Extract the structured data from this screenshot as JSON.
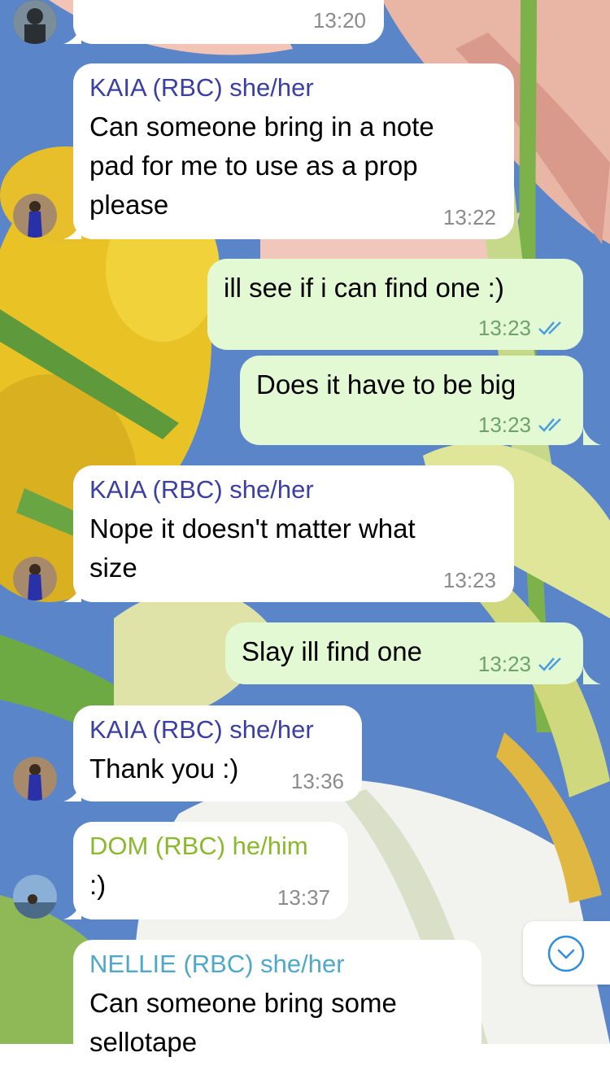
{
  "messages": [
    {
      "type": "in",
      "sender": "",
      "text": "",
      "time": "13:20"
    },
    {
      "type": "in",
      "sender": "KAIA (RBC) she/her",
      "sender_color": "#3b3fa3",
      "text": "Can someone bring in a note\npad for me to use as a prop\nplease",
      "time": "13:22"
    },
    {
      "type": "out",
      "text": "ill see if i can find one :)",
      "time": "13:23"
    },
    {
      "type": "out",
      "text": "Does it have to be big",
      "time": "13:23"
    },
    {
      "type": "in",
      "sender": "KAIA (RBC) she/her",
      "sender_color": "#3b3fa3",
      "text": "Nope it doesn't matter what\nsize",
      "time": "13:23"
    },
    {
      "type": "out",
      "text": "Slay ill find one",
      "time": "13:23"
    },
    {
      "type": "in",
      "sender": "KAIA (RBC) she/her",
      "sender_color": "#3b3fa3",
      "text": "Thank you :)",
      "time": "13:36"
    },
    {
      "type": "in",
      "sender": "DOM (RBC) he/him",
      "sender_color": "#8ab92d",
      "text": ":)",
      "time": "13:37"
    },
    {
      "type": "in",
      "sender": "NELLIE (RBC) she/her",
      "sender_color": "#4fa8c9",
      "text": "Can someone bring some\nsellotape",
      "time": ""
    }
  ],
  "icons": {
    "read": "double-check-icon",
    "scroll": "chevron-down-circle-icon"
  }
}
